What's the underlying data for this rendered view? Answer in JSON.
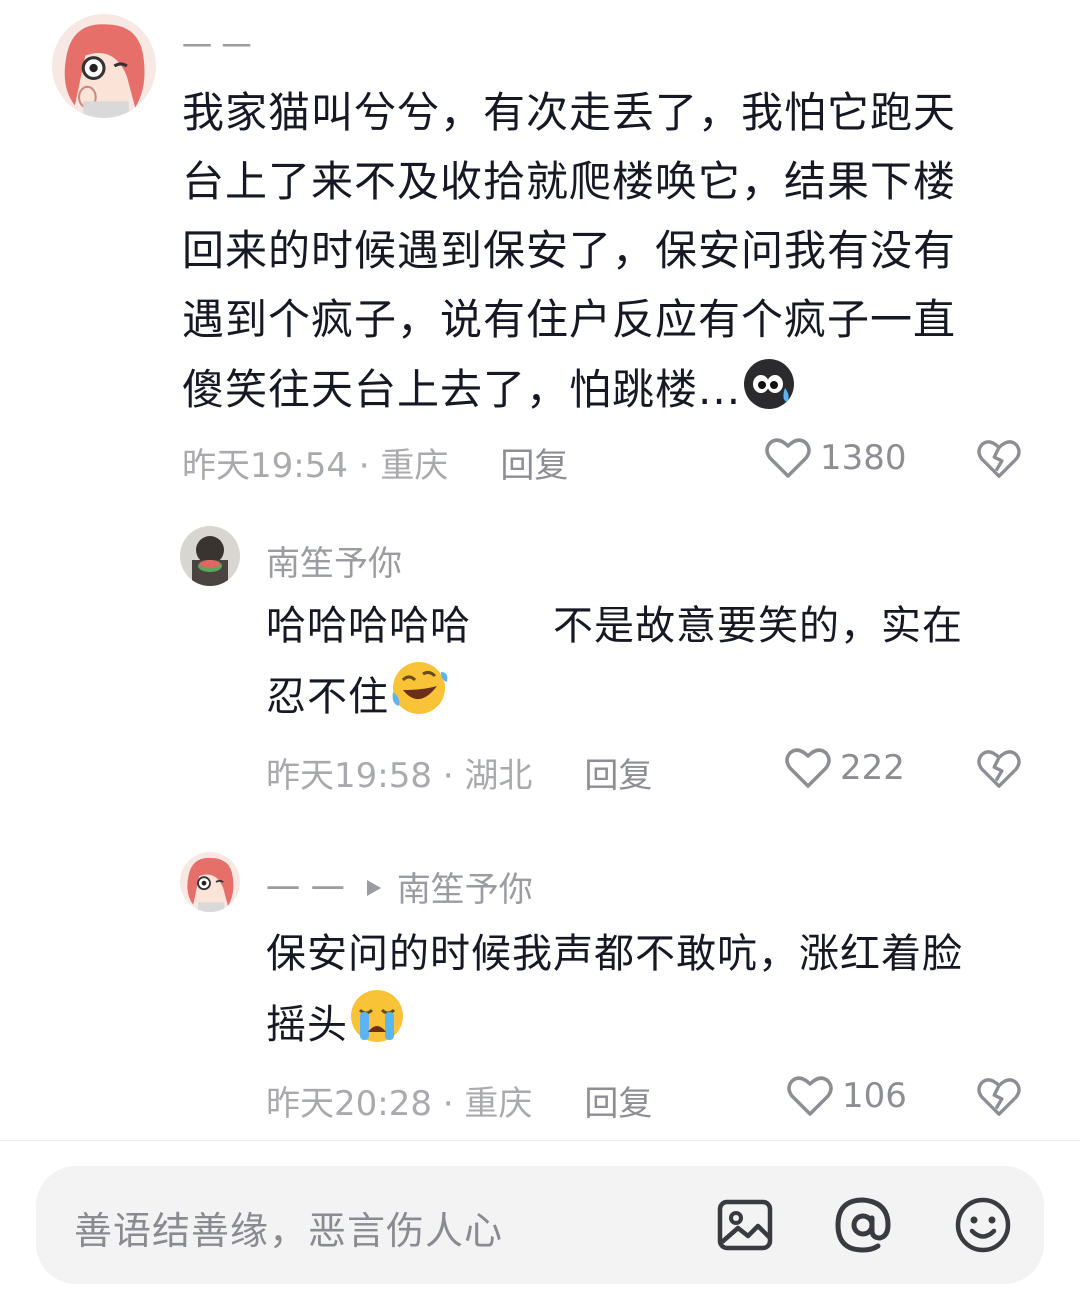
{
  "comments": [
    {
      "username": "一 一",
      "text_lines": [
        "我家猫叫兮兮，有次走丢了，我怕它跑天",
        "台上了来不及收拾就爬楼唤它，结果下楼",
        "回来的时候遇到保安了，保安问我有没有",
        "遇到个疯子，说有住户反应有个疯子一直",
        "傻笑往天台上去了，怕跳楼..."
      ],
      "emoji": "sweat-face",
      "time_location": "昨天19:54 · 重庆",
      "reply_label": "回复",
      "likes": "1380"
    },
    {
      "username": "南笙予你",
      "text_lines": [
        "哈哈哈哈哈　　不是故意要笑的，实在",
        "忍不住"
      ],
      "emoji": "rofl-face",
      "time_location": "昨天19:58 · 湖北",
      "reply_label": "回复",
      "likes": "222"
    },
    {
      "username": "一 一",
      "reply_to": "南笙予你",
      "text_lines": [
        "保安问的时候我声都不敢吭，涨红着脸",
        "摇头"
      ],
      "emoji": "crying-face",
      "time_location": "昨天20:28 · 重庆",
      "reply_label": "回复",
      "likes": "106"
    }
  ],
  "input": {
    "placeholder": "善语结善缘，恶言伤人心",
    "icons": [
      "image-icon",
      "at-icon",
      "emoji-icon"
    ]
  },
  "colors": {
    "text": "#161823",
    "secondary": "#9b9ca2",
    "input_bg": "#f3f3f4"
  }
}
